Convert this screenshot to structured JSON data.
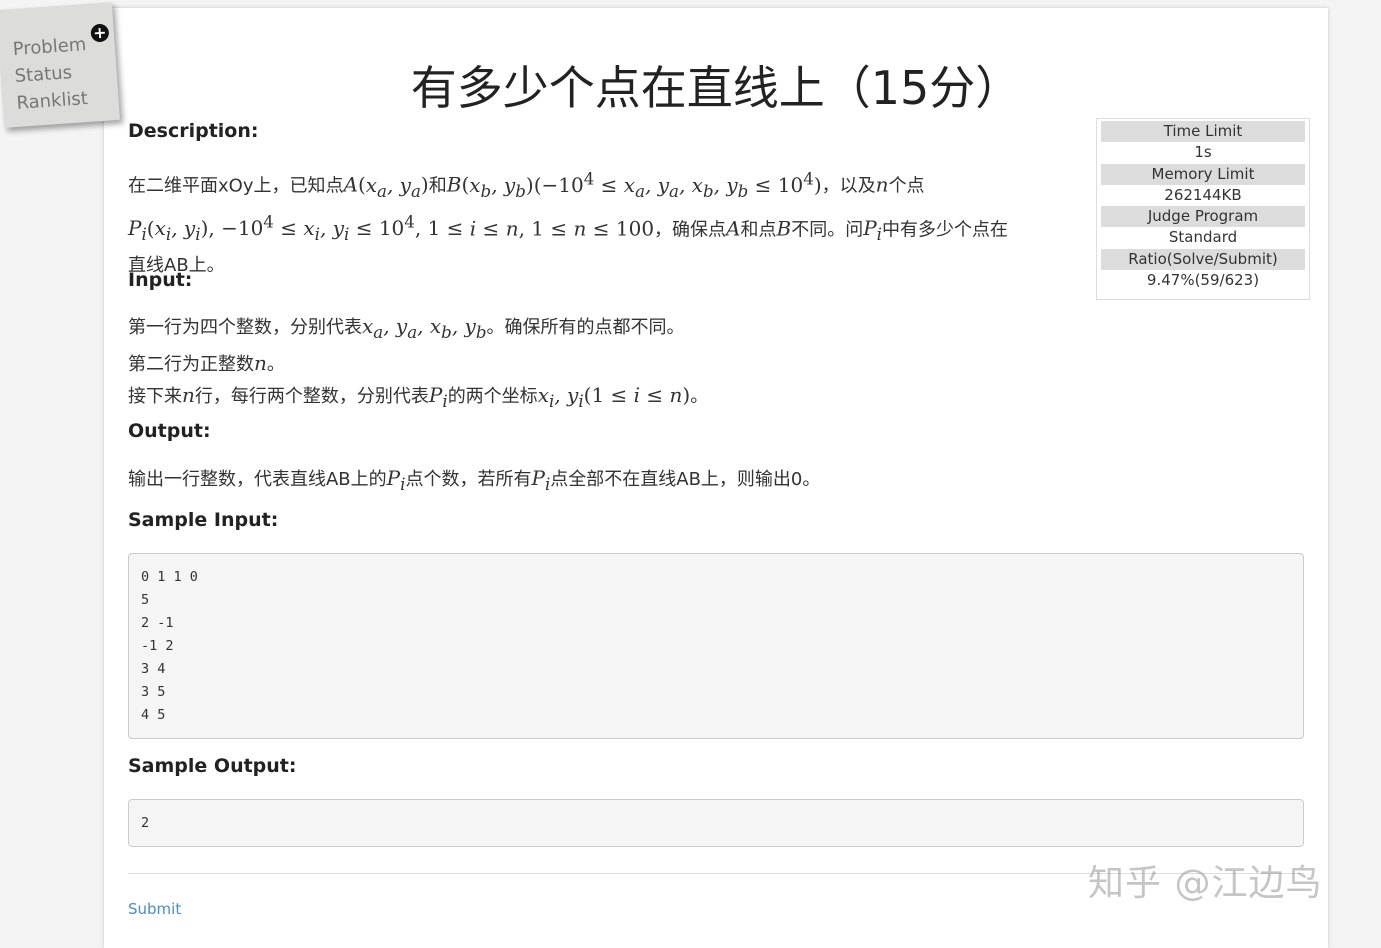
{
  "nav": {
    "items": [
      "Problem",
      "Status",
      "Ranklist"
    ]
  },
  "problem": {
    "title": "有多少个点在直线上（15分）"
  },
  "limits": {
    "time_label": "Time Limit",
    "time_value": "1s",
    "memory_label": "Memory Limit",
    "memory_value": "262144KB",
    "judge_label": "Judge Program",
    "judge_value": "Standard",
    "ratio_label": "Ratio(Solve/Submit)",
    "ratio_value": "9.47%(59/623)"
  },
  "description": {
    "heading": "Description:",
    "t1": "在二维平面xOy上，已知点",
    "t2": "和",
    "t3": "，以及",
    "t4": "个点",
    "t5": "，确保点",
    "t6": "和点",
    "t7": "不同。问",
    "t8": "中有多少个点在",
    "t9": "直线AB上。"
  },
  "input": {
    "heading": "Input:",
    "l1a": "第一行为四个整数，分别代表",
    "l1b": "。确保所有的点都不同。",
    "l2a": "第二行为正整数",
    "l2b": "。",
    "l3a": "接下来",
    "l3b": "行，每行两个整数，分别代表",
    "l3c": "的两个坐标",
    "l3d": "。"
  },
  "output": {
    "heading": "Output:",
    "t1": "输出一行整数，代表直线AB上的",
    "t2": "点个数，若所有",
    "t3": "点全部不在直线AB上，则输出0。"
  },
  "sample_input": {
    "heading": "Sample Input:",
    "lines": [
      "0 1 1 0",
      "5",
      "2 -1",
      "-1 2",
      "3 4",
      "3 5",
      "4 5"
    ]
  },
  "sample_output": {
    "heading": "Sample Output:",
    "lines": [
      "2"
    ]
  },
  "submit_label": "Submit",
  "watermark": "知乎 @江边鸟"
}
